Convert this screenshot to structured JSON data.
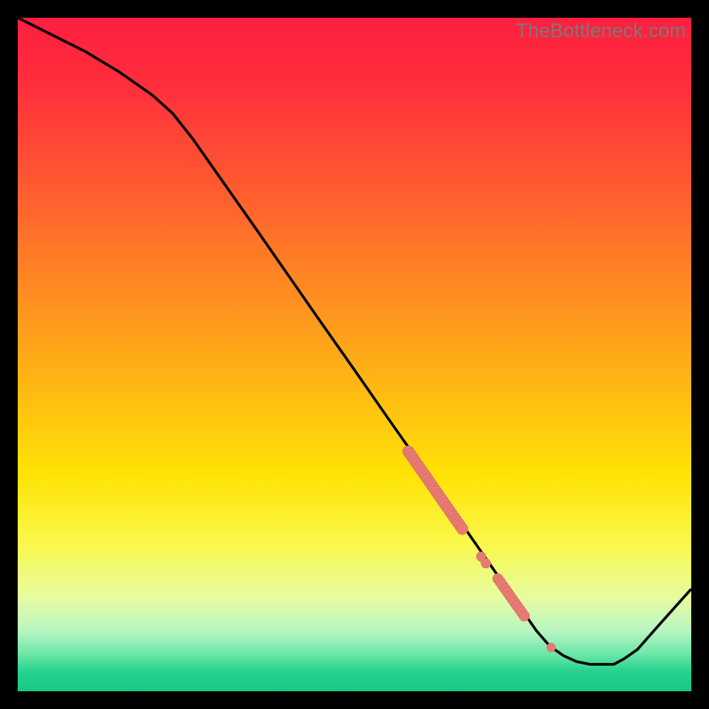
{
  "watermark": "TheBottleneck.com",
  "colors": {
    "gradient_stops": [
      {
        "offset": 0.0,
        "color": "#ff1f3f"
      },
      {
        "offset": 0.1,
        "color": "#ff2e3c"
      },
      {
        "offset": 0.25,
        "color": "#ff5a30"
      },
      {
        "offset": 0.4,
        "color": "#ff8a22"
      },
      {
        "offset": 0.55,
        "color": "#ffb913"
      },
      {
        "offset": 0.68,
        "color": "#ffe306"
      },
      {
        "offset": 0.78,
        "color": "#f9f84a"
      },
      {
        "offset": 0.86,
        "color": "#e8fca0"
      },
      {
        "offset": 0.91,
        "color": "#b8f6c2"
      },
      {
        "offset": 0.945,
        "color": "#6be6a8"
      },
      {
        "offset": 0.97,
        "color": "#27d38e"
      },
      {
        "offset": 1.0,
        "color": "#18c882"
      }
    ],
    "curve": "#000000",
    "marker_fill": "#e77b73",
    "marker_stroke": "#d66a62"
  },
  "chart_data": {
    "type": "line",
    "title": "",
    "xlabel": "",
    "ylabel": "",
    "xlim": [
      0,
      100
    ],
    "ylim": [
      0,
      100
    ],
    "curve_xy_percent": [
      [
        0,
        100
      ],
      [
        5,
        97.5
      ],
      [
        10,
        95
      ],
      [
        15,
        92
      ],
      [
        20,
        88.5
      ],
      [
        23,
        85.8
      ],
      [
        26,
        82
      ],
      [
        30,
        76.3
      ],
      [
        35,
        69.2
      ],
      [
        40,
        62
      ],
      [
        45,
        54.8
      ],
      [
        50,
        47.7
      ],
      [
        55,
        40.5
      ],
      [
        60,
        33.4
      ],
      [
        65,
        26.2
      ],
      [
        70,
        19
      ],
      [
        74,
        13.3
      ],
      [
        77,
        9
      ],
      [
        79,
        6.7
      ],
      [
        81,
        5.3
      ],
      [
        83,
        4.4
      ],
      [
        85,
        4
      ],
      [
        88.5,
        4
      ],
      [
        90,
        4.8
      ],
      [
        92,
        6.2
      ],
      [
        95,
        9.6
      ],
      [
        100,
        15.2
      ]
    ],
    "marker_clusters_xy_percent": [
      {
        "start": [
          58,
          35.6
        ],
        "end": [
          66,
          24.1
        ],
        "count": 26,
        "radius": 6.5
      },
      {
        "start": [
          68.8,
          20.0
        ],
        "end": [
          69.5,
          19.0
        ],
        "count": 2,
        "radius": 5.5
      },
      {
        "start": [
          71.3,
          16.7
        ],
        "end": [
          75.2,
          11.2
        ],
        "count": 12,
        "radius": 6.0
      },
      {
        "start": [
          79.2,
          6.5
        ],
        "end": [
          79.2,
          6.5
        ],
        "count": 1,
        "radius": 5.0
      }
    ]
  }
}
